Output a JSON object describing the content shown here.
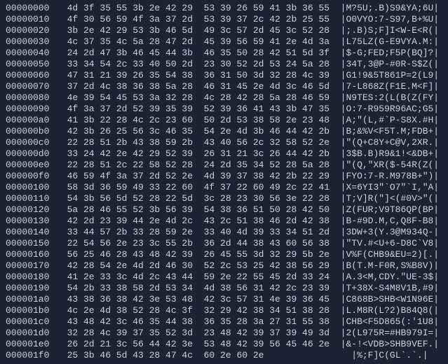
{
  "hexdump": {
    "rows": [
      {
        "addr": "00000000",
        "hex": "4d 3f 35 55 3b 2e 42 29  53 39 26 59 41 3b 36 55",
        "ascii": "|M?5U;.B)S9&YA;6U|"
      },
      {
        "addr": "00000010",
        "hex": "4f 30 56 59 4f 3a 37 2d  53 39 37 2c 42 2b 25 55",
        "ascii": "|O0VYO:7-S97,B+%U|"
      },
      {
        "addr": "00000020",
        "hex": "3b 2e 42 29 53 3b 46 5d  49 3c 57 2d 45 3c 52 28",
        "ascii": "|;.B)S;F]I<W-E<R(|"
      },
      {
        "addr": "00000030",
        "hex": "4c 37 35 4c 5a 28 47 2d  45 39 56 59 41 2e 4d 3a",
        "ascii": "|L75LZ(G-E9VYA.M:|"
      },
      {
        "addr": "00000040",
        "hex": "24 2d 47 3b 46 45 44 3b  46 35 50 28 42 51 5d 3f",
        "ascii": "|$-G;FED;F5P(BQ]?|"
      },
      {
        "addr": "00000050",
        "hex": "33 34 54 2c 33 40 50 2d  23 30 52 2d 53 24 5a 28",
        "ascii": "|34T,3@P-#0R-S$Z(|"
      },
      {
        "addr": "00000060",
        "hex": "47 31 21 39 26 35 54 38  36 31 50 3d 32 28 4c 39",
        "ascii": "|G1!9&5T861P=2(L9|"
      },
      {
        "addr": "00000070",
        "hex": "37 2d 4c 38 36 38 5a 28  46 31 45 2e 4d 3c 46 5d",
        "ascii": "|7-L868Z(F1E.M<F]|"
      },
      {
        "addr": "00000080",
        "hex": "4e 39 54 45 53 3a 32 28  4c 28 42 28 5a 28 46 59",
        "ascii": "|N9TES:2(L(B(Z(FY|"
      },
      {
        "addr": "00000090",
        "hex": "4f 3a 37 2d 52 39 35 39  52 39 36 41 43 3b 47 35",
        "ascii": "|O:7-R959R96AC;G5|"
      },
      {
        "addr": "000000a0",
        "hex": "41 3b 22 28 4c 2c 23 60  50 2d 53 38 58 2e 23 48",
        "ascii": "|A;\"(L,#`P-S8X.#H|"
      },
      {
        "addr": "000000b0",
        "hex": "42 3b 26 25 56 3c 46 35  54 2e 4d 3b 46 44 42 2b",
        "ascii": "|B;&%V<F5T.M;FDB+|"
      },
      {
        "addr": "000000c0",
        "hex": "22 28 51 2b 43 38 59 2b  43 40 56 2c 32 58 52 2e",
        "ascii": "|\"(Q+C8Y+C@V,2XR.|"
      },
      {
        "addr": "000000d0",
        "hex": "33 24 42 2e 42 29 52 39  26 31 21 3c 26 44 42 2b",
        "ascii": "|3$B.B)R9&1!<&DB+|"
      },
      {
        "addr": "000000e0",
        "hex": "22 28 51 2c 22 58 52 28  24 2d 35 34 52 28 5a 28",
        "ascii": "|\"(Q,\"XR($-54R(Z(|"
      },
      {
        "addr": "000000f0",
        "hex": "46 59 4f 3a 37 2d 52 2e  4d 39 37 38 42 2b 22 29",
        "ascii": "|FYO:7-R.M978B+\")|"
      },
      {
        "addr": "00000100",
        "hex": "58 3d 36 59 49 33 22 60  4f 37 22 60 49 2c 22 41",
        "ascii": "|X=6YI3\"`O7\"`I,\"A|"
      },
      {
        "addr": "00000110",
        "hex": "54 3b 56 5d 52 28 22 5d  3c 28 23 30 56 3e 22 28",
        "ascii": "|T;V]R(\"]<(#0V>\"(|"
      },
      {
        "addr": "00000120",
        "hex": "5a 28 46 55 52 3b 56 39  54 38 36 51 50 28 42 50",
        "ascii": "|Z(FUR;V9T86QP(BP|"
      },
      {
        "addr": "00000130",
        "hex": "42 2d 23 39 44 2e 4d 2c  43 2c 51 38 46 2d 42 38",
        "ascii": "|B-#9D.M,C,Q8F-B8|"
      },
      {
        "addr": "00000140",
        "hex": "33 44 57 2b 33 28 59 2e  33 40 4d 39 33 34 51 2d",
        "ascii": "|3DW+3(Y.3@M934Q-|"
      },
      {
        "addr": "00000150",
        "hex": "22 54 56 2e 23 3c 55 2b  36 2d 44 38 43 60 56 38",
        "ascii": "|\"TV.#<U+6-D8C`V8|"
      },
      {
        "addr": "00000160",
        "hex": "56 25 46 28 43 48 42 39  26 45 55 3d 32 29 5b 2e",
        "ascii": "|V%F(CHB9&EU=2)[.|"
      },
      {
        "addr": "00000170",
        "hex": "42 28 54 2e 4d 2d 46 30  52 2c 53 25 42 38 56 29",
        "ascii": "|B(T.M-F0R,S%B8V)|"
      },
      {
        "addr": "00000180",
        "hex": "41 2e 33 3c 4d 2c 43 44  59 2e 22 55 45 2d 33 24",
        "ascii": "|A.3<M,CDY.\"UE-3$|"
      },
      {
        "addr": "00000190",
        "hex": "54 2b 33 38 58 2d 53 34  4d 38 56 31 42 2c 23 39",
        "ascii": "|T+38X-S4M8V1B,#9|"
      },
      {
        "addr": "000001a0",
        "hex": "43 38 36 38 42 3e 53 48  42 3c 57 31 4e 39 36 45",
        "ascii": "|C868B>SHB<W1N96E|"
      },
      {
        "addr": "000001b0",
        "hex": "4c 2e 4d 38 52 28 4c 3f  32 29 42 38 34 51 38 28",
        "ascii": "|L.M8R(L?2)B84Q8(|"
      },
      {
        "addr": "000001c0",
        "hex": "43 48 42 3c 46 35 44 38  36 35 28 3a 27 31 55 38",
        "ascii": "|CHB<F5D865(:'1U8|"
      },
      {
        "addr": "000001d0",
        "hex": "32 28 4c 39 37 35 52 3d  23 48 42 39 37 39 49 3d",
        "ascii": "|2(L975R=#HB979I=|"
      },
      {
        "addr": "000001e0",
        "hex": "26 2d 21 3c 56 44 42 3e  53 48 42 39 56 45 46 2e",
        "ascii": "|&-!<VDB>SHB9VEF.|"
      },
      {
        "addr": "000001f0",
        "hex": "25 3b 46 5d 43 28 47 4c  60 2e 60 2e              ",
        "ascii": "|%;F]C(GL`.`.|"
      }
    ]
  }
}
